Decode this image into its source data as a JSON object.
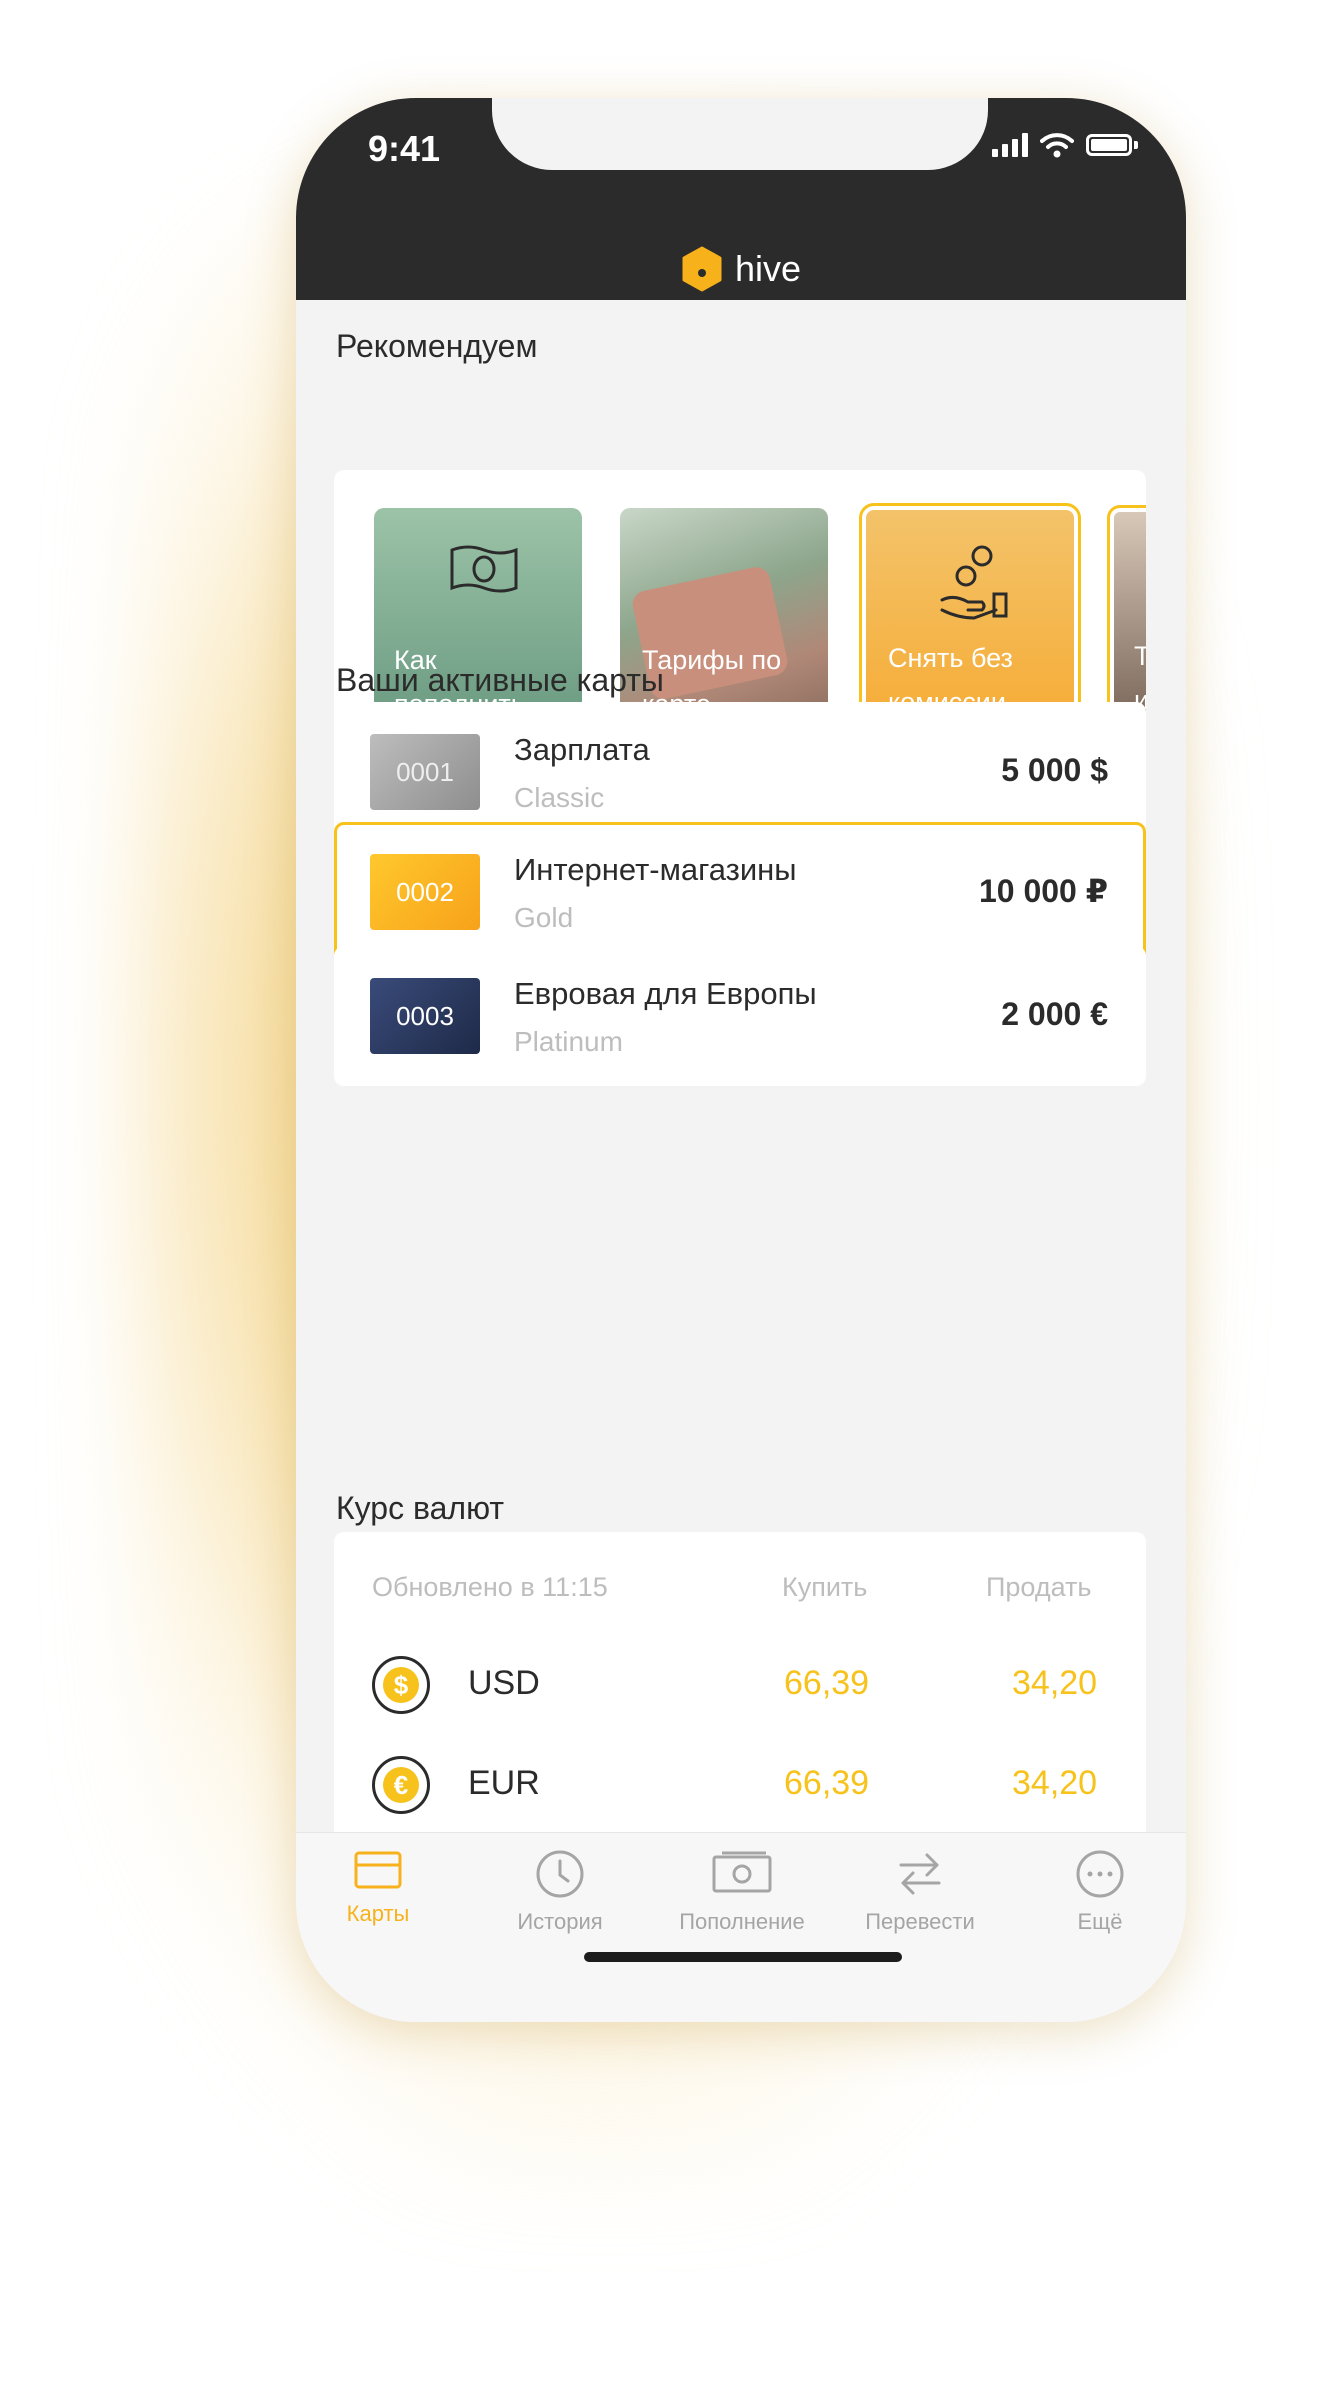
{
  "status": {
    "time": "9:41"
  },
  "app": {
    "brand": "hive",
    "accent": "#F7C21B"
  },
  "recommend": {
    "title": "Рекомендуем",
    "tiles": [
      {
        "label": "Как пополнить карту",
        "icon": "banknote-icon"
      },
      {
        "label": "Тарифы по карте",
        "icon": "wallet-photo"
      },
      {
        "label": "Снять без комиссии",
        "icon": "coins-hand-icon"
      },
      {
        "label": "Т и с",
        "icon": "photo"
      }
    ]
  },
  "cards": {
    "title": "Ваши активные карты",
    "items": [
      {
        "number": "0001",
        "name": "Зарплата",
        "type": "Classic",
        "amount": "5 000 $"
      },
      {
        "number": "0002",
        "name": "Интернет-магазины",
        "type": "Gold",
        "amount": "10 000 ₽"
      },
      {
        "number": "0003",
        "name": "Евровая для Европы",
        "type": "Platinum",
        "amount": "2 000 €"
      }
    ]
  },
  "rates": {
    "title": "Курс валют",
    "updated": "Обновлено в 11:15",
    "buy_label": "Купить",
    "sell_label": "Продать",
    "rows": [
      {
        "symbol": "$",
        "code": "USD",
        "buy": "66,39",
        "sell": "34,20"
      },
      {
        "symbol": "€",
        "code": "EUR",
        "buy": "66,39",
        "sell": "34,20"
      }
    ]
  },
  "tabbar": {
    "items": [
      {
        "label": "Карты",
        "icon": "card-icon",
        "active": true
      },
      {
        "label": "История",
        "icon": "clock-icon",
        "active": false
      },
      {
        "label": "Пополнение",
        "icon": "banknote-icon",
        "active": false
      },
      {
        "label": "Перевести",
        "icon": "transfer-arrows-icon",
        "active": false
      },
      {
        "label": "Ещё",
        "icon": "more-dots-icon",
        "active": false
      }
    ]
  }
}
